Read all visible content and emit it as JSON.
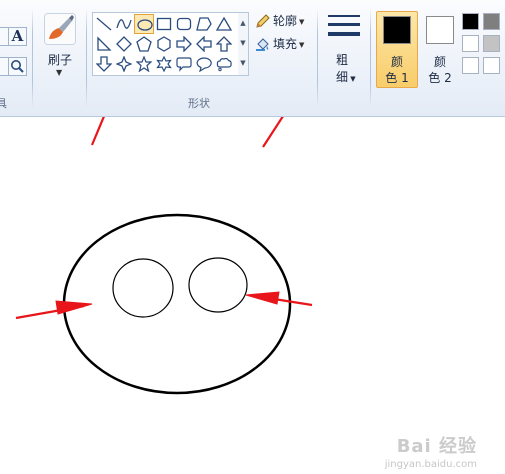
{
  "toolbar": {
    "text_tool_glyph": "A",
    "brush": {
      "label": "刷子"
    },
    "shapes": {
      "group_label": "形状",
      "selected": "oval",
      "items": [
        "line",
        "curve",
        "oval",
        "rectangle",
        "rounded-rectangle",
        "polygon",
        "triangle",
        "right-triangle",
        "diamond",
        "pentagon",
        "hexagon",
        "arrow-right",
        "arrow-left",
        "arrow-up",
        "arrow-down",
        "star-four",
        "star-five",
        "star-six",
        "callout-rounded",
        "callout-oval",
        "callout-cloud"
      ]
    },
    "outline": {
      "label": "轮廓"
    },
    "fill": {
      "label": "填充"
    },
    "size": {
      "label_top": "粗",
      "label_bottom": "细"
    },
    "color1": {
      "label_top": "颜",
      "label_bottom": "色 1",
      "value": "#000000"
    },
    "color2": {
      "label_top": "颜",
      "label_bottom": "色 2",
      "value": "#ffffff"
    },
    "palette": [
      "#000000",
      "#7f7f7f",
      "#ffffff",
      "#c3c3c3",
      "#ffffff",
      "#ffffff"
    ],
    "left_partial_label": "具"
  },
  "canvas": {
    "background": "#ffffff",
    "annotation_color": "#e8161b"
  },
  "watermark": {
    "text": "Bai 经验",
    "sub": "jingyan.baidu.com"
  }
}
